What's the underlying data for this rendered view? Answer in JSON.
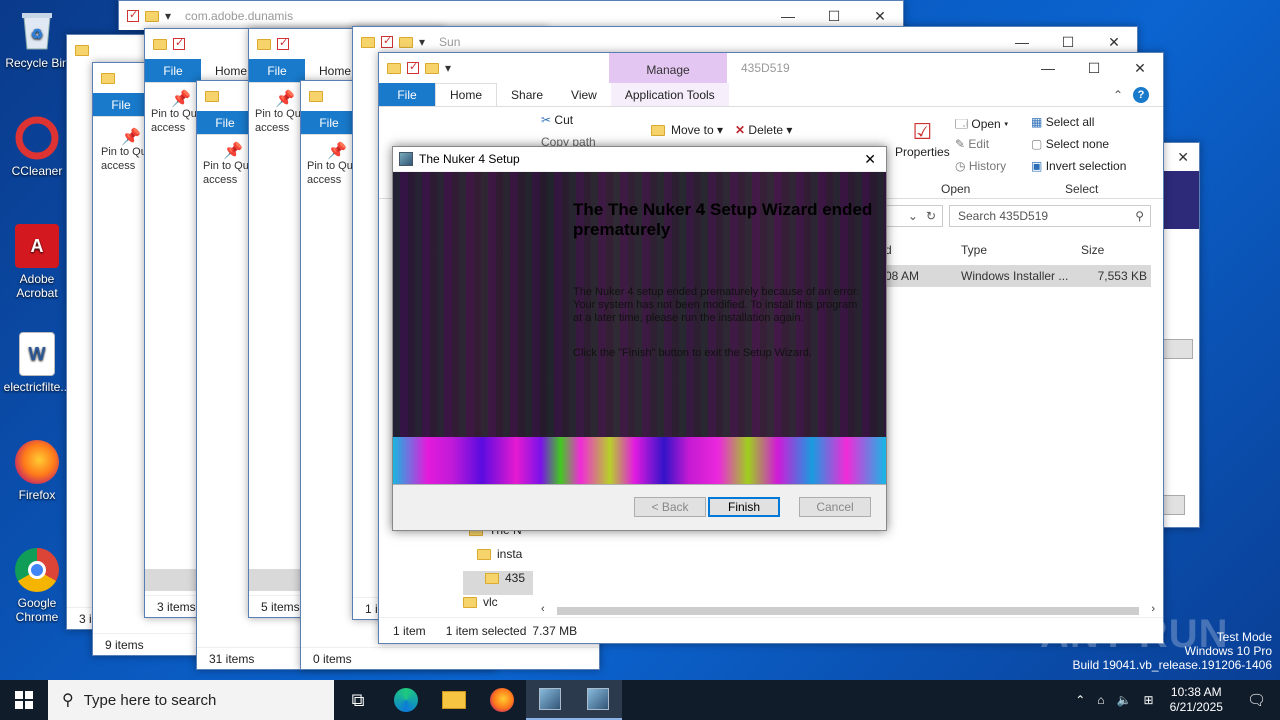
{
  "desktop_icons": [
    {
      "label": "Recycle Bin",
      "icon": "recycle-bin-icon"
    },
    {
      "label": "CCleaner",
      "icon": "ccleaner-icon"
    },
    {
      "label": "Adobe Acrobat",
      "icon": "acrobat-icon"
    },
    {
      "label": "electricfilte...",
      "icon": "word-doc-icon"
    },
    {
      "label": "Firefox",
      "icon": "firefox-icon"
    },
    {
      "label": "Google Chrome",
      "icon": "chrome-icon"
    }
  ],
  "back_windows": {
    "w1_title": "com.adobe.dunamis",
    "w5_title": "Sun",
    "file_tab": "File",
    "home_tab": "Home",
    "pin_label": "Pin to Quick access",
    "status_3": "3 items",
    "status_5": "5 items",
    "status_9": "9 items",
    "status_31": "31 items",
    "status_0": "0 items",
    "status_1i": "1 i",
    "status_3i": "3 i"
  },
  "main_window": {
    "title": "435D519",
    "manage_tab": "Manage",
    "tabs": [
      "File",
      "Home",
      "Share",
      "View",
      "Application Tools"
    ],
    "ribbon": {
      "cut": "Cut",
      "copy_path": "Copy path",
      "move_to": "Move to",
      "delete": "Delete",
      "properties": "Properties",
      "open": "Open",
      "edit": "Edit",
      "history": "History",
      "open_group": "Open",
      "select_all": "Select all",
      "select_none": "Select none",
      "invert_selection": "Invert selection",
      "select_group": "Select"
    },
    "search_placeholder": "Search 435D519",
    "columns": {
      "date_fragment": "d",
      "type": "Type",
      "size": "Size"
    },
    "row": {
      "date_fragment": "08 AM",
      "type": "Windows Installer ...",
      "size": "7,553 KB"
    },
    "tree": [
      "The N",
      "insta",
      "435",
      "vlc"
    ],
    "status": {
      "items": "1 item",
      "selected": "1 item selected",
      "size": "7.37 MB"
    }
  },
  "dialog": {
    "title": "The Nuker 4 Setup",
    "heading": "The The Nuker 4 Setup Wizard ended prematurely",
    "body1": "The Nuker 4 setup ended prematurely because of an error. Your system has not been modified. To install this program at a later time, please run the installation again.",
    "body2": "Click the \"Finish\" button to exit the Setup Wizard.",
    "back_btn": "< Back",
    "finish_btn": "Finish",
    "cancel_btn": "Cancel"
  },
  "taskbar": {
    "search_placeholder": "Type here to search",
    "time": "10:38 AM",
    "date": "6/21/2025"
  },
  "watermark": {
    "brand": "ANY RUN",
    "line1": "Test Mode",
    "line2": "Windows 10 Pro",
    "line3": "Build 19041.vb_release.191206-1406"
  }
}
